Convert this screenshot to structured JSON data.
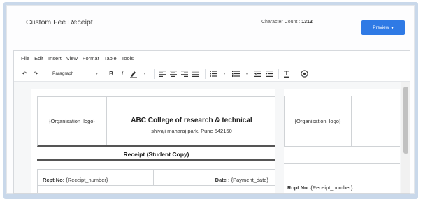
{
  "panel": {
    "title": "Custom Fee Receipt",
    "char_count_label": "Character Count :",
    "char_count_value": "1312",
    "preview_label": "Preview",
    "accent_color": "#2f7ae5"
  },
  "menubar": [
    "File",
    "Edit",
    "Insert",
    "View",
    "Format",
    "Table",
    "Tools"
  ],
  "toolbar": {
    "paragraph_label": "Paragraph",
    "bold_label": "B",
    "italic_label": "I",
    "icons": [
      "undo-icon",
      "redo-icon",
      "text-color-icon",
      "align-left-icon",
      "align-center-icon",
      "align-right-icon",
      "align-justify-icon",
      "bullet-list-icon",
      "numbered-list-icon",
      "outdent-icon",
      "indent-icon",
      "clear-format-icon",
      "help-icon"
    ]
  },
  "receipt": {
    "logo_placeholder": "{Organisation_logo}",
    "college_name": "ABC College of research & technical",
    "address": "shivaji maharaj park, Pune 542150",
    "title": "Receipt (Student Copy)",
    "rcpt_no_label": "Rcpt No:",
    "rcpt_no_value": "{Receipt_number}",
    "date_label": "Date :",
    "date_value": "{Payment_date}"
  },
  "receipt_copy2": {
    "logo_placeholder": "{Organisation_logo}",
    "rcpt_no_label": "Rcpt No:",
    "rcpt_no_value": "{Receipt_number}"
  }
}
